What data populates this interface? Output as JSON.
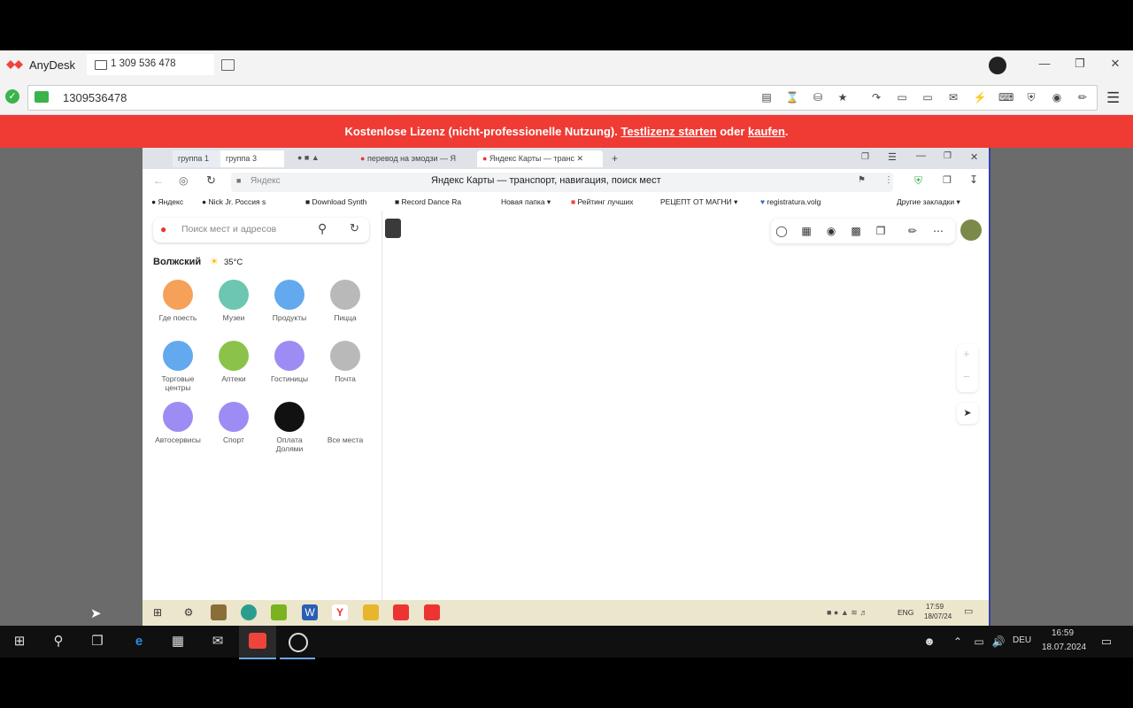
{
  "anydesk": {
    "app_name": "AnyDesk",
    "session_id": "1 309 536 478",
    "address_value": "1309536478",
    "colors": {
      "brand": "#ef443b",
      "ok": "#3bb34a",
      "banner": "#ef3b34"
    }
  },
  "banner": {
    "text_prefix": "Kostenlose Lizenz (nicht-professionelle Nutzung).",
    "link_trial": "Testlizenz starten",
    "middle": "oder",
    "link_buy": "kaufen",
    "suffix": "."
  },
  "remote": {
    "tabs": [
      "группа 1",
      "группа 3",
      "перевод на эмодзи — Я",
      "Яндекс Карты — транс"
    ],
    "url_host": "Яндекс",
    "page_title": "Яндекс Карты — транспорт, навигация, поиск мест",
    "bookmarks": [
      "Яндекс",
      "Nick Jr. Россия s",
      "Download Synth",
      "Record Dance Ra",
      "Новая папка",
      "Рейтинг лучших",
      "РЕЦЕПТ ОТ МАГНИ",
      "registratura.volg",
      "Другие закладки"
    ],
    "search_placeholder": "Поиск мест и адресов",
    "city": "Волжский",
    "weather": "35°C",
    "categories": [
      {
        "label": "Где поесть",
        "color": "#f5a15a"
      },
      {
        "label": "Музеи",
        "color": "#6cc6b0"
      },
      {
        "label": "Продукты",
        "color": "#62a9ee"
      },
      {
        "label": "Пицца",
        "color": "#b9b9b9"
      },
      {
        "label": "Торговые центры",
        "color": "#62a9ee"
      },
      {
        "label": "Аптеки",
        "color": "#8bc34a"
      },
      {
        "label": "Гостиницы",
        "color": "#9e8cf5"
      },
      {
        "label": "Почта",
        "color": "#b9b9b9"
      },
      {
        "label": "Автосервисы",
        "color": "#9e8cf5"
      },
      {
        "label": "Спорт",
        "color": "#9e8cf5"
      },
      {
        "label": "Оплата Долями",
        "color": "#111111"
      },
      {
        "label": "Все места",
        "color": "#ffffff"
      }
    ],
    "taskbar_lang": "ENG",
    "taskbar_time": "17:59",
    "taskbar_date": "18/07/24"
  },
  "host_taskbar": {
    "lang": "DEU",
    "time": "16:59",
    "date": "18.07.2024"
  }
}
